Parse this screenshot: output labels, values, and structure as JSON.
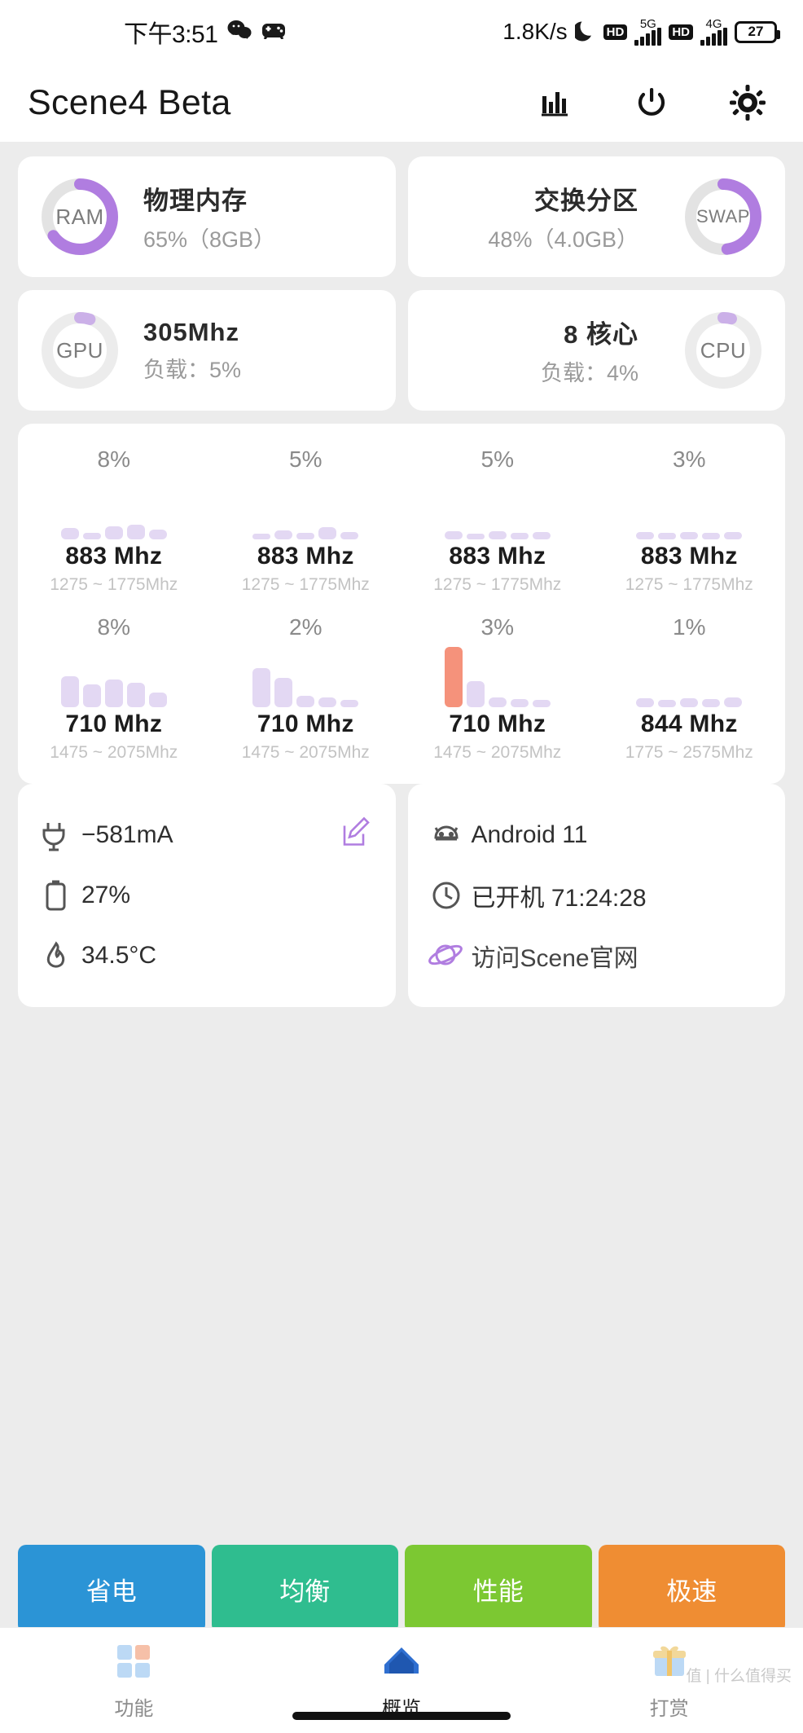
{
  "statusbar": {
    "time": "下午3:51",
    "network_speed": "1.8K/s",
    "hd_label_1": "HD",
    "gen_label_1": "5G",
    "hd_label_2": "HD",
    "gen_label_2": "4G",
    "battery_percent": "27"
  },
  "header": {
    "title": "Scene4 Beta",
    "actions": [
      "chart-icon",
      "power-icon",
      "gear-icon"
    ]
  },
  "memory": {
    "ram": {
      "ring_label": "RAM",
      "title": "物理内存",
      "sub": "65%（8GB）",
      "percent": 65
    },
    "swap": {
      "ring_label": "SWAP",
      "title": "交换分区",
      "sub": "48%（4.0GB）",
      "percent": 48
    }
  },
  "processors": {
    "gpu": {
      "ring_label": "GPU",
      "title": "305Mhz",
      "sub": "负载：5%",
      "percent": 5
    },
    "cpu": {
      "ring_label": "CPU",
      "title": "8 核心",
      "sub": "负载：4%",
      "percent": 4
    }
  },
  "cores": [
    {
      "pct": "8%",
      "freq": "883 Mhz",
      "range": "1275 ~ 1775Mhz",
      "bars": [
        14,
        8,
        16,
        18,
        12
      ],
      "hot": -1
    },
    {
      "pct": "5%",
      "freq": "883 Mhz",
      "range": "1275 ~ 1775Mhz",
      "bars": [
        7,
        11,
        8,
        15,
        9
      ],
      "hot": -1
    },
    {
      "pct": "5%",
      "freq": "883 Mhz",
      "range": "1275 ~ 1775Mhz",
      "bars": [
        10,
        7,
        10,
        8,
        9
      ],
      "hot": -1
    },
    {
      "pct": "3%",
      "freq": "883 Mhz",
      "range": "1275 ~ 1775Mhz",
      "bars": [
        9,
        8,
        9,
        8,
        9
      ],
      "hot": -1
    },
    {
      "pct": "8%",
      "freq": "710 Mhz",
      "range": "1475 ~ 2075Mhz",
      "bars": [
        38,
        28,
        34,
        30,
        18
      ],
      "hot": -1
    },
    {
      "pct": "2%",
      "freq": "710 Mhz",
      "range": "1475 ~ 2075Mhz",
      "bars": [
        48,
        36,
        14,
        12,
        9
      ],
      "hot": -1
    },
    {
      "pct": "3%",
      "freq": "710 Mhz",
      "range": "1475 ~ 2075Mhz",
      "bars": [
        120,
        32,
        12,
        10,
        9
      ],
      "hot": 0
    },
    {
      "pct": "1%",
      "freq": "844 Mhz",
      "range": "1775 ~ 2575Mhz",
      "bars": [
        11,
        9,
        11,
        10,
        12
      ],
      "hot": -1
    }
  ],
  "battery_card": [
    {
      "icon": "plug-icon",
      "text": "−581mA",
      "action_icon": "edit-icon"
    },
    {
      "icon": "battery-icon",
      "text": "27%"
    },
    {
      "icon": "temperature-icon",
      "text": "34.5°C"
    }
  ],
  "system_card": [
    {
      "icon": "android-icon",
      "text": "Android 11"
    },
    {
      "icon": "clock-icon",
      "text": "已开机  71:24:28"
    },
    {
      "icon": "planet-icon",
      "text": "访问Scene官网"
    }
  ],
  "modes": [
    {
      "label": "省电",
      "color": "#2b94d6"
    },
    {
      "label": "均衡",
      "color": "#2fbd8f"
    },
    {
      "label": "性能",
      "color": "#7cc832"
    },
    {
      "label": "极速",
      "color": "#ef8d33"
    }
  ],
  "bottomnav": [
    {
      "label": "功能",
      "icon": "modules-icon"
    },
    {
      "label": "概览",
      "icon": "home-icon"
    },
    {
      "label": "打赏",
      "icon": "gift-icon"
    }
  ],
  "watermark": "值 | 什么值得买",
  "colors": {
    "accent_purple": "#b07de0",
    "track_grey": "#e3e3e3",
    "bar_light": "#e3d8f3",
    "bar_hot": "#f5927b"
  }
}
